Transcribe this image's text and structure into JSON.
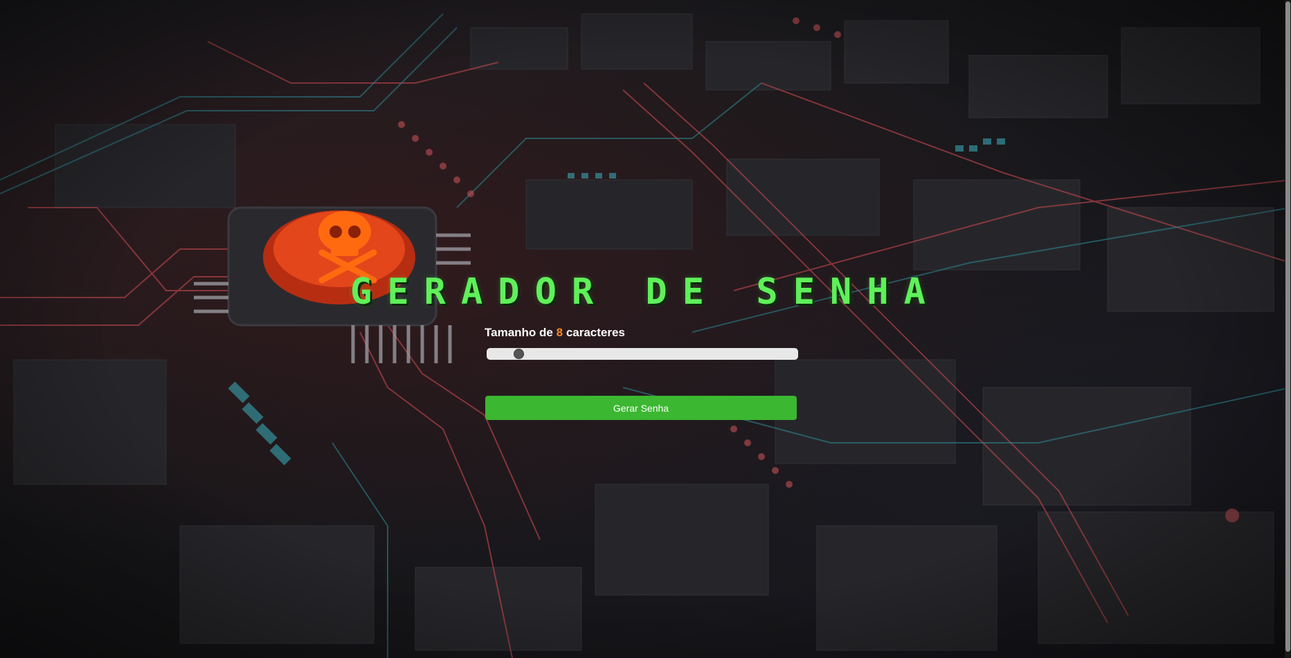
{
  "header": {
    "title": "GERADOR DE SENHA"
  },
  "length_control": {
    "label_prefix": "Tamanho de",
    "value": "8",
    "label_suffix": "caracteres",
    "min": 6,
    "max": 32,
    "level": 0.08
  },
  "actions": {
    "generate_label": "Gerar Senha"
  },
  "colors": {
    "title": "#5ff05a",
    "value_accent": "#ff8a1f",
    "button": "#3cb731",
    "skull": "#ff6a10"
  },
  "background": {
    "icon": "skull-crossbones-chip-icon"
  }
}
